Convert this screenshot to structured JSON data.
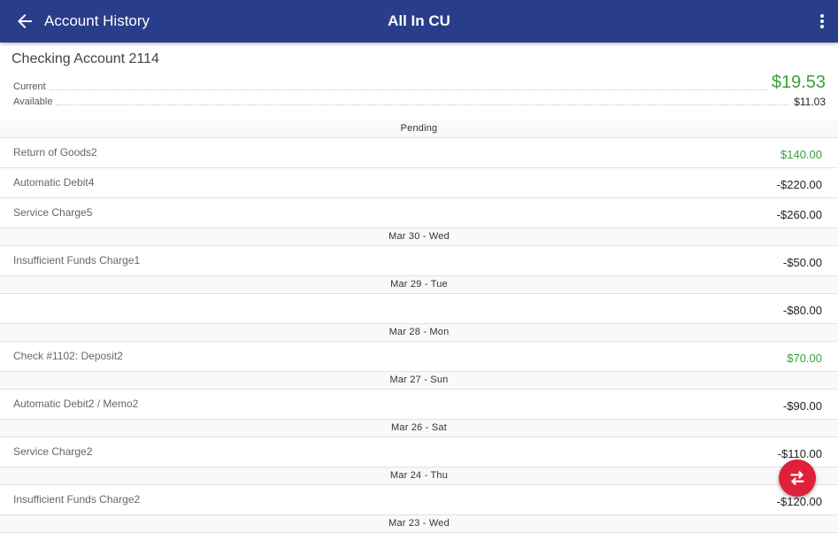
{
  "appbar": {
    "title": "Account History",
    "brand": "All In CU"
  },
  "account": {
    "name": "Checking Account 2114",
    "current_label": "Current",
    "current_amount": "$19.53",
    "available_label": "Available",
    "available_amount": "$11.03"
  },
  "history": {
    "pending_label": "Pending",
    "pending": [
      {
        "desc": "Return of Goods2",
        "amount": "$140.00",
        "credit": true
      },
      {
        "desc": "Automatic Debit4",
        "amount": "-$220.00",
        "credit": false
      },
      {
        "desc": "Service Charge5",
        "amount": "-$260.00",
        "credit": false
      }
    ],
    "groups": [
      {
        "date": "Mar 30 - Wed",
        "items": [
          {
            "desc": "Insufficient Funds Charge1",
            "amount": "-$50.00",
            "credit": false
          }
        ]
      },
      {
        "date": "Mar 29 - Tue",
        "items": [
          {
            "desc": "",
            "amount": "-$80.00",
            "credit": false
          }
        ]
      },
      {
        "date": "Mar 28 - Mon",
        "items": [
          {
            "desc": "Check #1102: Deposit2",
            "amount": "$70.00",
            "credit": true
          }
        ]
      },
      {
        "date": "Mar 27 - Sun",
        "items": [
          {
            "desc": "Automatic Debit2 / Memo2",
            "amount": "-$90.00",
            "credit": false
          }
        ]
      },
      {
        "date": "Mar 26 - Sat",
        "items": [
          {
            "desc": "Service Charge2",
            "amount": "-$110.00",
            "credit": false
          }
        ]
      },
      {
        "date": "Mar 24 - Thu",
        "items": [
          {
            "desc": "Insufficient Funds Charge2",
            "amount": "-$120.00",
            "credit": false
          }
        ]
      },
      {
        "date": "Mar 23 - Wed",
        "items": []
      }
    ]
  },
  "icons": {
    "back": "arrow-left-icon",
    "menu": "more-vert-icon",
    "fab": "transfer-icon"
  },
  "colors": {
    "appbar": "#283e8a",
    "credit": "#3aa03a",
    "fab": "#e0203a"
  }
}
